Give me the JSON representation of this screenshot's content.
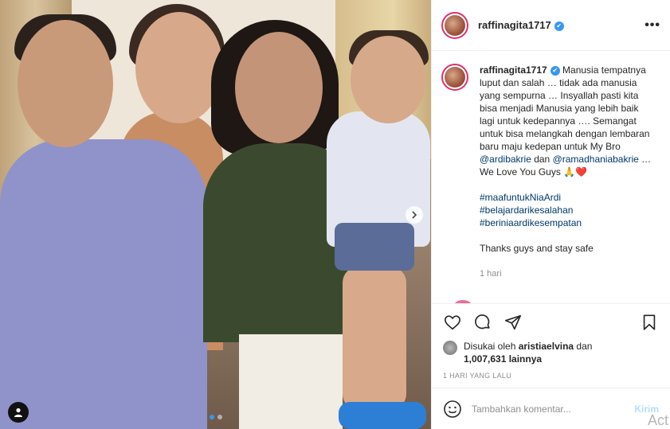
{
  "post": {
    "username": "raffinagita1717",
    "verified_mark": "✔",
    "more_label": "•••",
    "caption": {
      "username": "raffinagita1717",
      "text_part1": " Manusia tempatnya luput dan salah … tidak ada manusia yang sempurna … Insyallah pasti kita bisa menjadi Manusia yang lebih baik lagi untuk kedepannya …. Semangat untuk bisa melangkah dengan lembaran baru maju kedepan untuk My Bro ",
      "mention1": "@ardibakrie",
      "text_and": " dan ",
      "mention2": "@ramadhaniabakrie",
      "text_part2": " … We Love You Guys 🙏❤️",
      "hashtags": [
        "#maafuntukNiaArdi",
        "#belajardarikesalahan",
        "#beriniaardikesempatan"
      ],
      "thanks": "Thanks guys and stay safe",
      "time": "1 hari"
    },
    "likes": {
      "prefix": "Disukai oleh ",
      "user": "aristiaelvina",
      "mid": " dan",
      "count": "1,007,631 lainnya"
    },
    "date": "1 HARI YANG LALU",
    "comment_placeholder": "Tambahkan komentar...",
    "post_button": "Kirim",
    "watermark": "Act",
    "icons": {
      "like": "heart-icon",
      "comment": "comment-icon",
      "share": "share-icon",
      "save": "bookmark-icon",
      "emoji": "smiley-icon",
      "user_tag": "user-tag-icon",
      "next": "chevron-right-icon"
    },
    "carousel": {
      "count": 2,
      "active": 1
    }
  }
}
